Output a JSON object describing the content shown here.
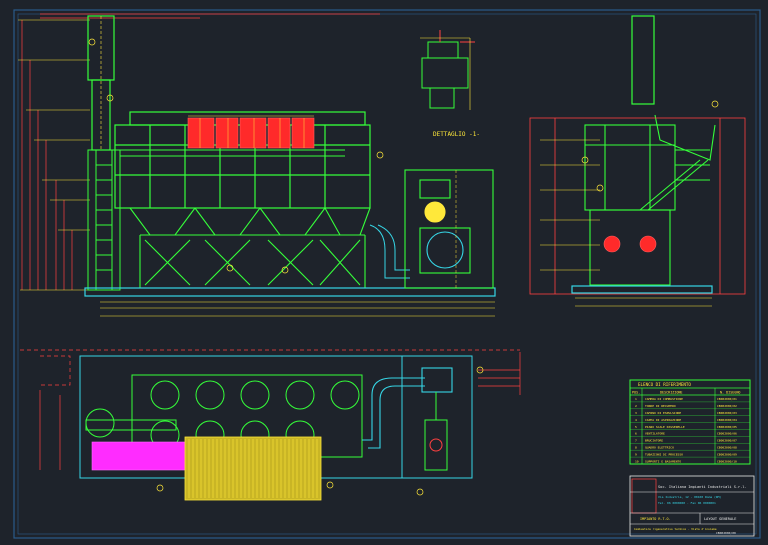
{
  "colors": {
    "background": "#1e232b",
    "frame": "#2a5b8a",
    "green": "#35ff3a",
    "red": "#ff2a2a",
    "yellow": "#ffe83a",
    "cyan": "#36d6e6",
    "magenta": "#ff2cff",
    "white": "#e8e8e8"
  },
  "detail": {
    "caption": "DETTAGLIO -1-"
  },
  "legend_table": {
    "title": "ELENCO DI RIFERIMENTO",
    "col_pos": "POS.",
    "col_desc": "DESCRIZIONE",
    "col_code": "N. DISEGNO",
    "rows": [
      {
        "pos": "1",
        "desc": "CAMERA DI COMBUSTIONE",
        "code": "CB002000/01"
      },
      {
        "pos": "2",
        "desc": "TORRE DI RECUPERO",
        "code": "CB002000/02"
      },
      {
        "pos": "3",
        "desc": "CAMINO DI ESPULSIONE",
        "code": "CB002000/03"
      },
      {
        "pos": "4",
        "desc": "CAPPA DI ASPIRAZIONE",
        "code": "CB002000/04"
      },
      {
        "pos": "5",
        "desc": "PIANO SCALE PASSERELLE",
        "code": "CB002000/05"
      },
      {
        "pos": "6",
        "desc": "VENTILATORE",
        "code": "CB002000/06"
      },
      {
        "pos": "7",
        "desc": "BRUCIATORE",
        "code": "CB002000/07"
      },
      {
        "pos": "8",
        "desc": "QUADRO ELETTRICO",
        "code": "CB002000/08"
      },
      {
        "pos": "9",
        "desc": "TUBAZIONI DI PROCESSO",
        "code": "CB002000/09"
      },
      {
        "pos": "10",
        "desc": "SUPPORTI E BASAMENTO",
        "code": "CB002000/10"
      }
    ]
  },
  "title_block": {
    "company": "Soc. Italiana Impianti Industriali S.r.l.",
    "address1": "Via Industria, 12 - 00100 Roma (RM)",
    "address2": "Tel. 06 0000000 - Fax 06 0000001",
    "drawing_label": "IMPIANTO R.T.O.",
    "drawing_title": "LAYOUT GENERALE",
    "subject": "Combustore rigenerativo termico - Vista d'insieme",
    "number": "CB002000/00"
  }
}
